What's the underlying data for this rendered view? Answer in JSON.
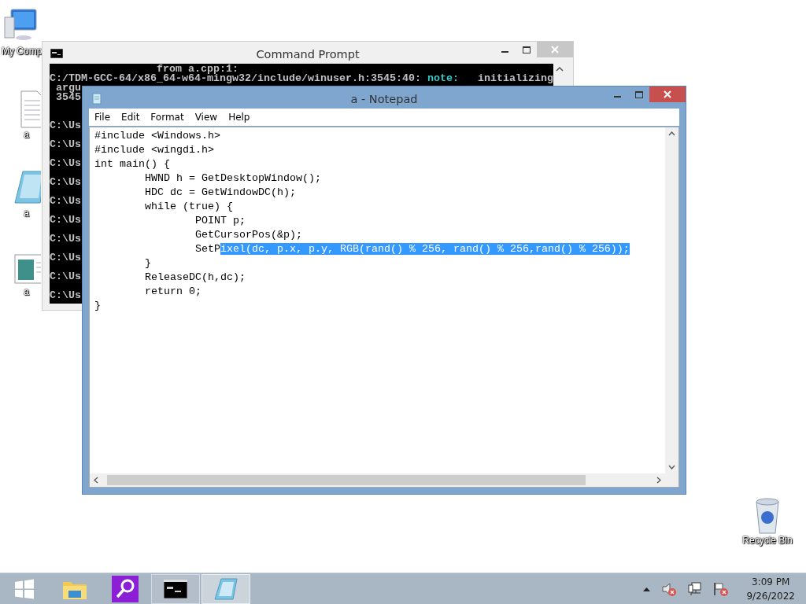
{
  "desktop_icons": [
    {
      "kind": "computer",
      "label": "My Comp"
    },
    {
      "kind": "textfile",
      "label": "a"
    },
    {
      "kind": "notepad",
      "label": "a"
    },
    {
      "kind": "image",
      "label": "a"
    },
    {
      "kind": "recycle",
      "label": "Recycle Bin"
    }
  ],
  "command_prompt": {
    "title": "Command Prompt",
    "active": false,
    "lines": [
      {
        "kind": "output",
        "segments": [
          {
            "text": "                 from a.cpp:1:"
          }
        ]
      },
      {
        "kind": "output",
        "segments": [
          {
            "text": "C:/TDM-GCC-64/x86_64-w64-mingw32/include/winuser.h:3545:40: "
          },
          {
            "text": "note:",
            "color": "#3ac4c4"
          },
          {
            "text": "   initializing"
          }
        ]
      },
      {
        "kind": "output",
        "segments": [
          {
            "text": " argu"
          }
        ]
      },
      {
        "kind": "output",
        "segments": [
          {
            "text": " 3545"
          }
        ]
      },
      {
        "kind": "prompt",
        "segments": [
          {
            "text": "C:\\Us"
          }
        ]
      },
      {
        "kind": "prompt",
        "segments": [
          {
            "text": "C:\\Us"
          }
        ]
      },
      {
        "kind": "prompt",
        "segments": [
          {
            "text": "C:\\Us"
          }
        ]
      },
      {
        "kind": "prompt",
        "segments": [
          {
            "text": "C:\\Us"
          }
        ]
      },
      {
        "kind": "prompt",
        "segments": [
          {
            "text": "C:\\Us"
          }
        ]
      },
      {
        "kind": "prompt",
        "segments": [
          {
            "text": "C:\\Us"
          }
        ]
      },
      {
        "kind": "prompt",
        "segments": [
          {
            "text": "C:\\Us"
          }
        ]
      },
      {
        "kind": "prompt",
        "segments": [
          {
            "text": "C:\\Us"
          }
        ]
      },
      {
        "kind": "prompt",
        "segments": [
          {
            "text": "C:\\Us"
          }
        ]
      },
      {
        "kind": "prompt",
        "segments": [
          {
            "text": "C:\\Us"
          }
        ]
      }
    ]
  },
  "notepad": {
    "title": "a - Notepad",
    "active": true,
    "menu": [
      "File",
      "Edit",
      "Format",
      "View",
      "Help"
    ],
    "lines": [
      {
        "segments": [
          {
            "text": "#include <Windows.h>",
            "selected": false
          }
        ]
      },
      {
        "segments": [
          {
            "text": "#include <wingdi.h>",
            "selected": false
          }
        ]
      },
      {
        "segments": [
          {
            "text": "int main() {",
            "selected": false
          }
        ]
      },
      {
        "segments": [
          {
            "text": "\tHWND h = GetDesktopWindow();",
            "selected": false
          }
        ]
      },
      {
        "segments": [
          {
            "text": "\tHDC dc = GetWindowDC(h);",
            "selected": false
          }
        ]
      },
      {
        "segments": [
          {
            "text": "\twhile (true) {",
            "selected": false
          }
        ]
      },
      {
        "segments": [
          {
            "text": "\t\tPOINT p;",
            "selected": false
          }
        ]
      },
      {
        "segments": [
          {
            "text": "\t\tGetCursorPos(&p);",
            "selected": false
          }
        ]
      },
      {
        "segments": [
          {
            "text": "\t\tSetP",
            "selected": false
          },
          {
            "text": "ixel(dc, p.x, p.y, RGB(rand() % 256, rand() % 256,rand() % 256));",
            "selected": true
          }
        ]
      },
      {
        "segments": [
          {
            "text": "\t}",
            "selected": false
          }
        ]
      },
      {
        "segments": [
          {
            "text": "\tReleaseDC(h,dc);",
            "selected": false
          }
        ]
      },
      {
        "segments": [
          {
            "text": "\treturn 0;",
            "selected": false
          }
        ]
      },
      {
        "segments": [
          {
            "text": "}",
            "selected": false
          }
        ]
      }
    ]
  },
  "taskbar": {
    "apps": [
      {
        "kind": "start",
        "selected": false
      },
      {
        "kind": "explorer",
        "selected": false
      },
      {
        "kind": "magnifier",
        "selected": false
      },
      {
        "kind": "cmd",
        "selected": false
      },
      {
        "kind": "notepad",
        "selected": true
      }
    ],
    "time": "3:09 PM",
    "date": "9/26/2022"
  }
}
